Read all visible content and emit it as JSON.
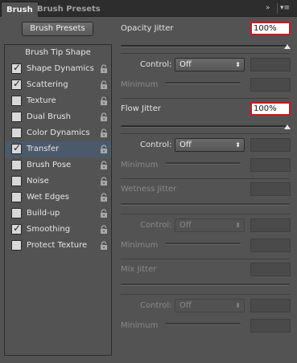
{
  "tabs": [
    {
      "label": "Brush"
    },
    {
      "label": "Brush Presets"
    }
  ],
  "tabbar": {
    "collapse_icon": "»",
    "menu_icon": "▾≡"
  },
  "presets_button": "Brush Presets",
  "left_panel": {
    "header": "Brush Tip Shape",
    "items": [
      {
        "label": "Shape Dynamics",
        "checked": true,
        "selected": false
      },
      {
        "label": "Scattering",
        "checked": true,
        "selected": false
      },
      {
        "label": "Texture",
        "checked": false,
        "selected": false
      },
      {
        "label": "Dual Brush",
        "checked": false,
        "selected": false
      },
      {
        "label": "Color Dynamics",
        "checked": false,
        "selected": false
      },
      {
        "label": "Transfer",
        "checked": true,
        "selected": true
      },
      {
        "label": "Brush Pose",
        "checked": false,
        "selected": false
      },
      {
        "label": "Noise",
        "checked": false,
        "selected": false
      },
      {
        "label": "Wet Edges",
        "checked": false,
        "selected": false
      },
      {
        "label": "Build-up",
        "checked": false,
        "selected": false
      },
      {
        "label": "Smoothing",
        "checked": true,
        "selected": false
      },
      {
        "label": "Protect Texture",
        "checked": false,
        "selected": false
      }
    ]
  },
  "opacity": {
    "label": "Opacity Jitter",
    "value": "100%",
    "control_label": "Control:",
    "control_value": "Off",
    "minimum_label": "Minimum"
  },
  "flow": {
    "label": "Flow Jitter",
    "value": "100%",
    "control_label": "Control:",
    "control_value": "Off",
    "minimum_label": "Minimum"
  },
  "wetness": {
    "label": "Wetness Jitter",
    "control_label": "Control:",
    "control_value": "Off",
    "minimum_label": "Minimum"
  },
  "mix": {
    "label": "Mix Jitter",
    "control_label": "Control:",
    "control_value": "Off",
    "minimum_label": "Minimum"
  },
  "colors": {
    "highlight_border": "#d4141c",
    "selected_row": "#4b5a6a",
    "panel_bg": "#535353"
  }
}
